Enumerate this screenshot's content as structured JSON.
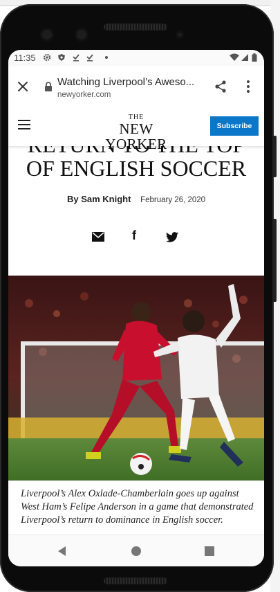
{
  "status_bar": {
    "time": "11:35",
    "icons": [
      "settings-icon",
      "shield-icon",
      "download-done-icon",
      "download-done-icon",
      "dot-icon",
      "wifi-icon",
      "signal-icon",
      "battery-icon"
    ]
  },
  "tab_bar": {
    "title": "Watching Liverpool’s Aweso...",
    "url": "newyorker.com",
    "icons": [
      "close-icon",
      "lock-icon",
      "share-icon",
      "more-vert-icon"
    ]
  },
  "site_header": {
    "logo_the": "THE",
    "logo_name": "NEW YORKER",
    "subscribe_label": "Subscribe",
    "brand_color": "#0a77c9"
  },
  "article": {
    "headline_line1": "RETURN TO THE TOP",
    "headline_line2": "OF ENGLISH SOCCER",
    "byline_prefix": "By",
    "author": "Sam Knight",
    "date": "February 26, 2020",
    "share_icons": [
      "email-icon",
      "facebook-icon",
      "twitter-icon"
    ],
    "facebook_glyph": "f",
    "caption": "Liverpool’s Alex Oxlade-Chamberlain goes up against West Ham’s Felipe Anderson in a game that demonstrated Liverpool’s return to dominance in English soccer."
  },
  "nav_bar": {
    "icons": [
      "back-icon",
      "home-icon",
      "recents-icon"
    ]
  }
}
